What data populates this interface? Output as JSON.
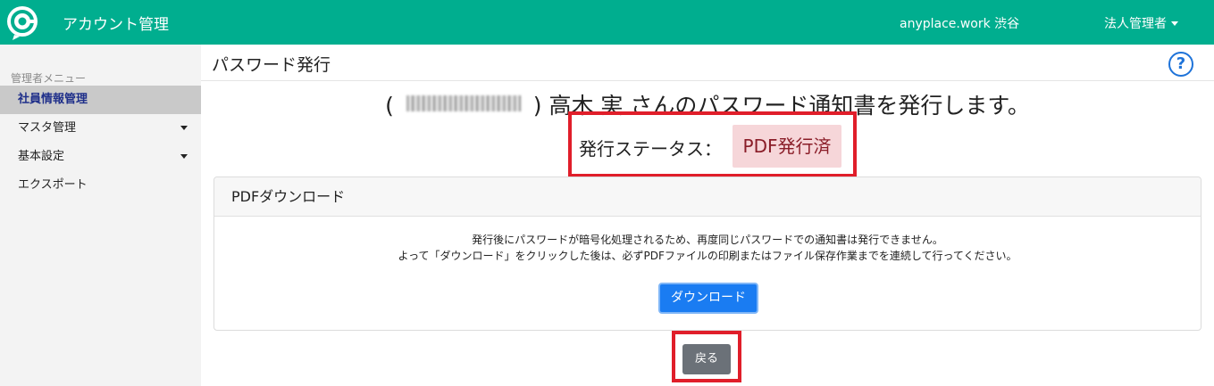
{
  "header": {
    "app_title": "アカウント管理",
    "workspace": "anyplace.work 渋谷",
    "user_menu": "法人管理者"
  },
  "sidebar": {
    "heading": "管理者メニュー",
    "items": [
      {
        "label": "社員情報管理",
        "active": true,
        "has_submenu": false
      },
      {
        "label": "マスタ管理",
        "active": false,
        "has_submenu": true
      },
      {
        "label": "基本設定",
        "active": false,
        "has_submenu": true
      },
      {
        "label": "エクスポート",
        "active": false,
        "has_submenu": false
      }
    ]
  },
  "main": {
    "page_title": "パスワード発行",
    "help_symbol": "?",
    "notice": {
      "open_paren": "(",
      "close_paren": ")",
      "employee_name": "高木 実",
      "message": "さんのパスワード通知書を発行します。"
    },
    "status": {
      "label": "発行ステータス：",
      "value": "PDF発行済"
    },
    "card": {
      "header": "PDFダウンロード",
      "line1": "発行後にパスワードが暗号化処理されるため、再度同じパスワードでの通知書は発行できません。",
      "line2": "よって「ダウンロード」をクリックした後は、必ずPDFファイルの印刷またはファイル保存作業までを連続して行ってください。",
      "download_label": "ダウンロード"
    },
    "back_label": "戻る"
  },
  "colors": {
    "brand": "#00ae8f",
    "primary_button": "#1a7cf2",
    "secondary_button": "#6b7178",
    "status_badge_bg": "#f6d6d9",
    "highlight_border": "#e01e2a",
    "help_icon": "#1e73d9"
  }
}
